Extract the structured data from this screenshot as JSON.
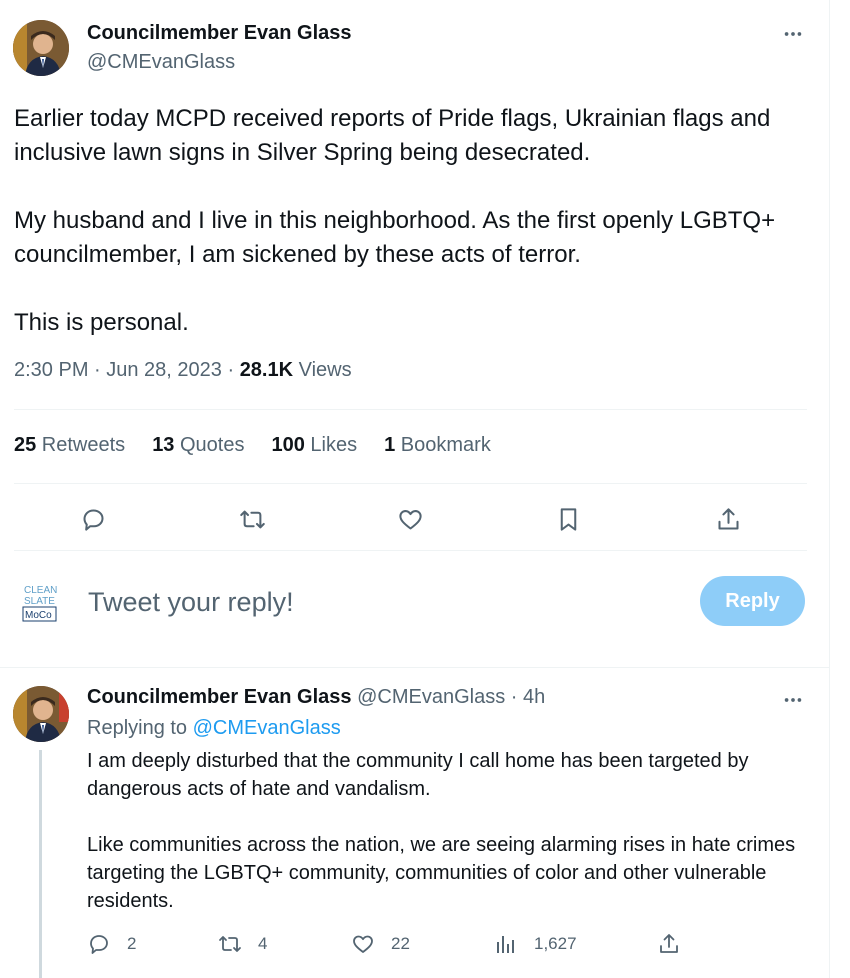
{
  "colors": {
    "accent": "#1d9bf0",
    "reply_button_bg": "#8ecdf8",
    "muted": "#536471",
    "text": "#0f1419"
  },
  "tweet": {
    "author_name": "Councilmember Evan Glass",
    "author_handle": "@CMEvanGlass",
    "paragraphs": [
      "Earlier today MCPD received reports of Pride flags, Ukrainian flags and inclusive lawn signs in Silver Spring being desecrated.",
      "My husband and I live in this neighborhood. As the first openly LGBTQ+ councilmember, I am sickened by these acts of terror.",
      "This is personal."
    ],
    "time": "2:30 PM · Jun 28, 2023 · ",
    "views_count": "28.1K",
    "views_label": " Views",
    "stats": {
      "retweets_count": "25",
      "retweets_label": " Retweets",
      "quotes_count": "13",
      "quotes_label": " Quotes",
      "likes_count": "100",
      "likes_label": " Likes",
      "bookmarks_count": "1",
      "bookmarks_label": " Bookmark"
    },
    "actions": [
      "reply-icon",
      "retweet-icon",
      "like-icon",
      "bookmark-icon",
      "share-icon"
    ]
  },
  "composer": {
    "avatar_logo_lines": [
      "CLEAN",
      "SLATE",
      "MoCo"
    ],
    "placeholder": "Tweet your reply!",
    "button_label": "Reply"
  },
  "reply": {
    "author_name": "Councilmember Evan Glass",
    "author_handle": "@CMEvanGlass",
    "time_ago": " · 4h",
    "replying_prefix": "Replying to ",
    "replying_handle": "@CMEvanGlass",
    "paragraphs": [
      "I am deeply disturbed that the community I call home has been targeted by dangerous acts of hate and vandalism.",
      "Like communities across the nation, we are seeing alarming rises in hate crimes targeting the LGBTQ+ community, communities of color and other vulnerable residents."
    ],
    "replies_count": "2",
    "retweets_count": "4",
    "likes_count": "22",
    "views_count": "1,627"
  }
}
